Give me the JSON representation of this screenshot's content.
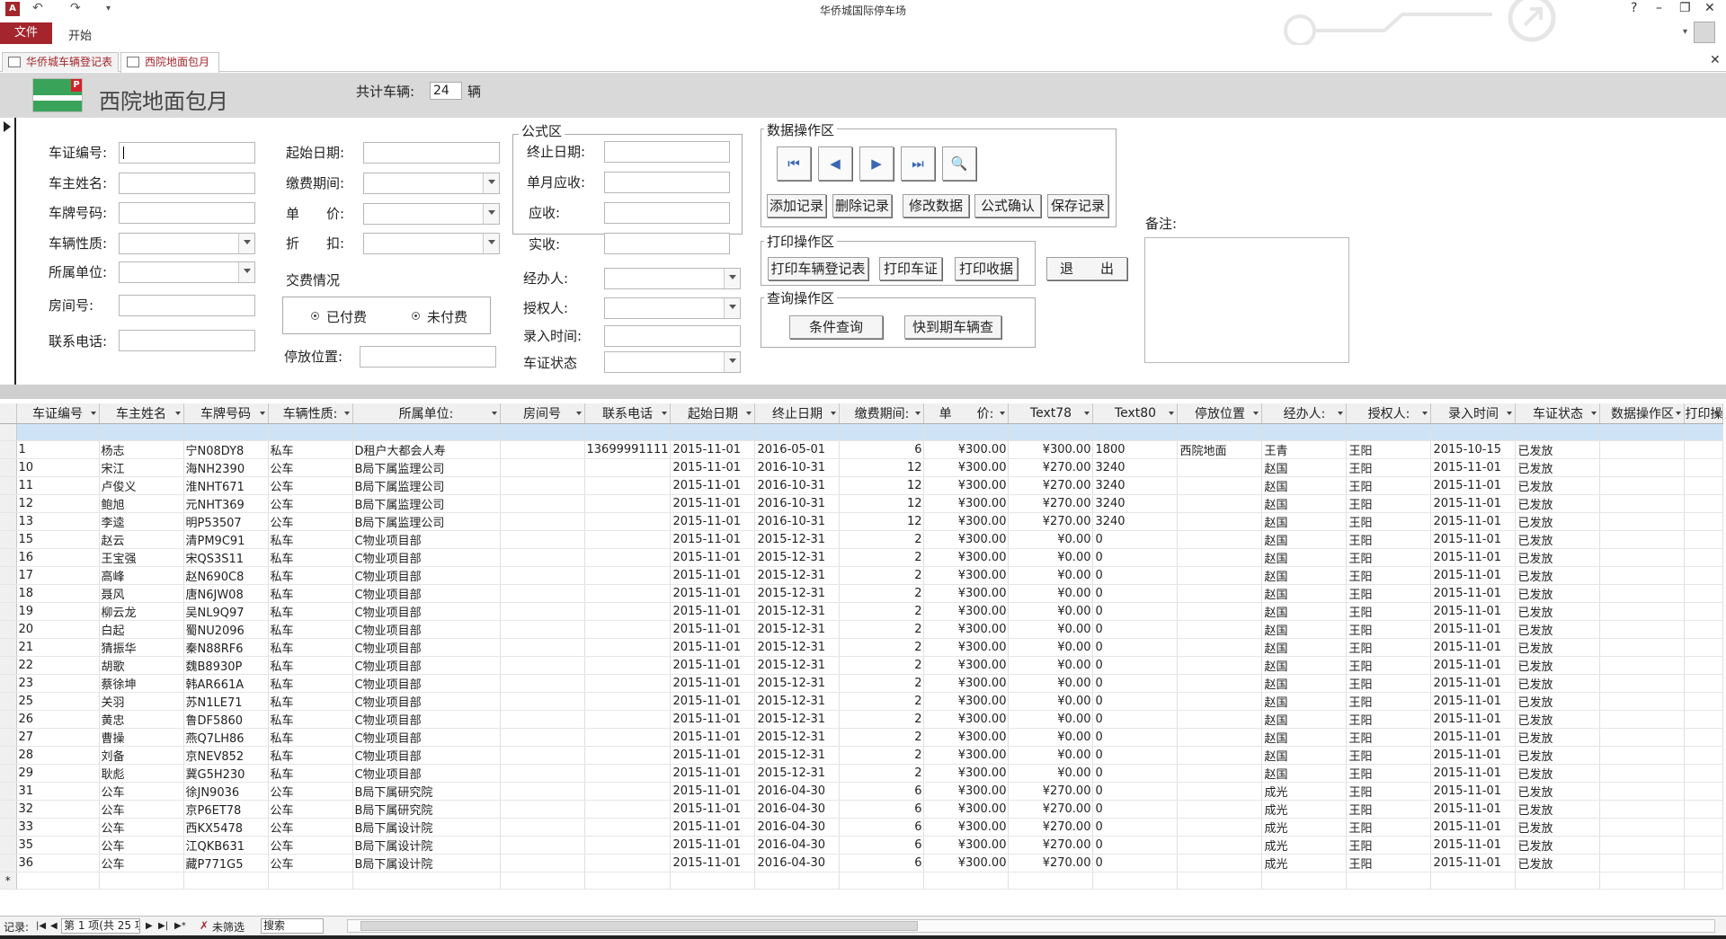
{
  "window": {
    "title": "华侨城国际停车场",
    "help": "?",
    "minimize": "–",
    "restore": "❐",
    "close": "✕"
  },
  "quick_access": {
    "undo": "↶",
    "redo": "↷",
    "customize": "▾"
  },
  "ribbon": {
    "file": "文件",
    "home": "开始"
  },
  "doc_tabs": [
    "华侨城车辆登记表",
    "西院地面包月"
  ],
  "header": {
    "title": "西院地面包月",
    "total_label": "共计车辆:",
    "total_count": "24",
    "total_unit": "辆"
  },
  "form": {
    "labels": {
      "cert_no": "车证编号:",
      "owner": "车主姓名:",
      "plate": "车牌号码:",
      "nature": "车辆性质:",
      "unit": "所属单位:",
      "room": "房间号:",
      "phone": "联系电话:",
      "start_date": "起始日期:",
      "pay_period": "缴费期间:",
      "price": "单　　价:",
      "discount": "折　　扣:",
      "payment": "交费情况",
      "paid": "已付费",
      "unpaid": "未付费",
      "park_pos": "停放位置:",
      "formula_area": "公式区",
      "end_date": "终止日期:",
      "monthly_due": "单月应收:",
      "due": "应收:",
      "received": "实收:",
      "handler": "经办人:",
      "authorizer": "授权人:",
      "entry_time": "录入时间:",
      "cert_status": "车证状态",
      "data_ops": "数据操作区",
      "print_ops": "打印操作区",
      "query_ops": "查询操作区",
      "notes": "备注:"
    },
    "buttons": {
      "add": "添加记录",
      "delete": "删除记录",
      "edit": "修改数据",
      "formula": "公式确认",
      "save": "保存记录",
      "print_reg": "打印车辆登记表",
      "print_cert": "打印车证",
      "print_receipt": "打印收据",
      "exit": "退　　出",
      "cond_query": "条件查询",
      "expiring_query": "快到期车辆查"
    },
    "nav_icons": {
      "first": "⏮",
      "prev": "◀",
      "next": "▶",
      "last": "⏭",
      "find": "🔍"
    }
  },
  "table": {
    "columns": [
      "车证编号",
      "车主姓名",
      "车牌号码",
      "车辆性质:",
      "所属单位:",
      "房间号",
      "联系电话",
      "起始日期",
      "终止日期",
      "缴费期间:",
      "单　　价:",
      "Text78",
      "Text80",
      "停放位置",
      "经办人:",
      "授权人:",
      "录入时间",
      "车证状态",
      "数据操作区",
      "打印操"
    ],
    "rows": [
      [
        "1",
        "杨志",
        "宁N08DY8",
        "私车",
        "D租户大都会人寿",
        "",
        "13699991111",
        "2015-11-01",
        "2016-05-01",
        "6",
        "¥300.00",
        "¥300.00",
        "1800",
        "西院地面",
        "王青",
        "王阳",
        "2015-10-15",
        "已发放",
        "",
        ""
      ],
      [
        "10",
        "宋江",
        "海NH2390",
        "公车",
        "B局下属监理公司",
        "",
        "",
        "2015-11-01",
        "2016-10-31",
        "12",
        "¥300.00",
        "¥270.00",
        "3240",
        "",
        "赵国",
        "王阳",
        "2015-11-01",
        "已发放",
        "",
        ""
      ],
      [
        "11",
        "卢俊义",
        "淮NHT671",
        "公车",
        "B局下属监理公司",
        "",
        "",
        "2015-11-01",
        "2016-10-31",
        "12",
        "¥300.00",
        "¥270.00",
        "3240",
        "",
        "赵国",
        "王阳",
        "2015-11-01",
        "已发放",
        "",
        ""
      ],
      [
        "12",
        "鲍旭",
        "元NHT369",
        "公车",
        "B局下属监理公司",
        "",
        "",
        "2015-11-01",
        "2016-10-31",
        "12",
        "¥300.00",
        "¥270.00",
        "3240",
        "",
        "赵国",
        "王阳",
        "2015-11-01",
        "已发放",
        "",
        ""
      ],
      [
        "13",
        "李逵",
        "明P53507",
        "公车",
        "B局下属监理公司",
        "",
        "",
        "2015-11-01",
        "2016-10-31",
        "12",
        "¥300.00",
        "¥270.00",
        "3240",
        "",
        "赵国",
        "王阳",
        "2015-11-01",
        "已发放",
        "",
        ""
      ],
      [
        "15",
        "赵云",
        "清PM9C91",
        "私车",
        "C物业项目部",
        "",
        "",
        "2015-11-01",
        "2015-12-31",
        "2",
        "¥300.00",
        "¥0.00",
        "0",
        "",
        "赵国",
        "王阳",
        "2015-11-01",
        "已发放",
        "",
        ""
      ],
      [
        "16",
        "王宝强",
        "宋QS3S11",
        "私车",
        "C物业项目部",
        "",
        "",
        "2015-11-01",
        "2015-12-31",
        "2",
        "¥300.00",
        "¥0.00",
        "0",
        "",
        "赵国",
        "王阳",
        "2015-11-01",
        "已发放",
        "",
        ""
      ],
      [
        "17",
        "高峰",
        "赵N690C8",
        "私车",
        "C物业项目部",
        "",
        "",
        "2015-11-01",
        "2015-12-31",
        "2",
        "¥300.00",
        "¥0.00",
        "0",
        "",
        "赵国",
        "王阳",
        "2015-11-01",
        "已发放",
        "",
        ""
      ],
      [
        "18",
        "聂风",
        "唐N6JW08",
        "私车",
        "C物业项目部",
        "",
        "",
        "2015-11-01",
        "2015-12-31",
        "2",
        "¥300.00",
        "¥0.00",
        "0",
        "",
        "赵国",
        "王阳",
        "2015-11-01",
        "已发放",
        "",
        ""
      ],
      [
        "19",
        "柳云龙",
        "吴NL9Q97",
        "私车",
        "C物业项目部",
        "",
        "",
        "2015-11-01",
        "2015-12-31",
        "2",
        "¥300.00",
        "¥0.00",
        "0",
        "",
        "赵国",
        "王阳",
        "2015-11-01",
        "已发放",
        "",
        ""
      ],
      [
        "20",
        "白起",
        "蜀NU2096",
        "私车",
        "C物业项目部",
        "",
        "",
        "2015-11-01",
        "2015-12-31",
        "2",
        "¥300.00",
        "¥0.00",
        "0",
        "",
        "赵国",
        "王阳",
        "2015-11-01",
        "已发放",
        "",
        ""
      ],
      [
        "21",
        "猜振华",
        "秦N88RF6",
        "私车",
        "C物业项目部",
        "",
        "",
        "2015-11-01",
        "2015-12-31",
        "2",
        "¥300.00",
        "¥0.00",
        "0",
        "",
        "赵国",
        "王阳",
        "2015-11-01",
        "已发放",
        "",
        ""
      ],
      [
        "22",
        "胡歌",
        "魏B8930P",
        "私车",
        "C物业项目部",
        "",
        "",
        "2015-11-01",
        "2015-12-31",
        "2",
        "¥300.00",
        "¥0.00",
        "0",
        "",
        "赵国",
        "王阳",
        "2015-11-01",
        "已发放",
        "",
        ""
      ],
      [
        "23",
        "蔡徐坤",
        "韩AR661A",
        "私车",
        "C物业项目部",
        "",
        "",
        "2015-11-01",
        "2015-12-31",
        "2",
        "¥300.00",
        "¥0.00",
        "0",
        "",
        "赵国",
        "王阳",
        "2015-11-01",
        "已发放",
        "",
        ""
      ],
      [
        "25",
        "关羽",
        "苏N1LE71",
        "私车",
        "C物业项目部",
        "",
        "",
        "2015-11-01",
        "2015-12-31",
        "2",
        "¥300.00",
        "¥0.00",
        "0",
        "",
        "赵国",
        "王阳",
        "2015-11-01",
        "已发放",
        "",
        ""
      ],
      [
        "26",
        "黄忠",
        "鲁DF5860",
        "私车",
        "C物业项目部",
        "",
        "",
        "2015-11-01",
        "2015-12-31",
        "2",
        "¥300.00",
        "¥0.00",
        "0",
        "",
        "赵国",
        "王阳",
        "2015-11-01",
        "已发放",
        "",
        ""
      ],
      [
        "27",
        "曹操",
        "燕Q7LH86",
        "私车",
        "C物业项目部",
        "",
        "",
        "2015-11-01",
        "2015-12-31",
        "2",
        "¥300.00",
        "¥0.00",
        "0",
        "",
        "赵国",
        "王阳",
        "2015-11-01",
        "已发放",
        "",
        ""
      ],
      [
        "28",
        "刘备",
        "京NEV852",
        "私车",
        "C物业项目部",
        "",
        "",
        "2015-11-01",
        "2015-12-31",
        "2",
        "¥300.00",
        "¥0.00",
        "0",
        "",
        "赵国",
        "王阳",
        "2015-11-01",
        "已发放",
        "",
        ""
      ],
      [
        "29",
        "耿彪",
        "冀G5H230",
        "私车",
        "C物业项目部",
        "",
        "",
        "2015-11-01",
        "2015-12-31",
        "2",
        "¥300.00",
        "¥0.00",
        "0",
        "",
        "赵国",
        "王阳",
        "2015-11-01",
        "已发放",
        "",
        ""
      ],
      [
        "31",
        "公车",
        "徐JN9036",
        "公车",
        "B局下属研究院",
        "",
        "",
        "2015-11-01",
        "2016-04-30",
        "6",
        "¥300.00",
        "¥270.00",
        "0",
        "",
        "成光",
        "王阳",
        "2015-11-01",
        "已发放",
        "",
        ""
      ],
      [
        "32",
        "公车",
        "京P6ET78",
        "公车",
        "B局下属研究院",
        "",
        "",
        "2015-11-01",
        "2016-04-30",
        "6",
        "¥300.00",
        "¥270.00",
        "0",
        "",
        "成光",
        "王阳",
        "2015-11-01",
        "已发放",
        "",
        ""
      ],
      [
        "33",
        "公车",
        "西KX5478",
        "公车",
        "B局下属设计院",
        "",
        "",
        "2015-11-01",
        "2016-04-30",
        "6",
        "¥300.00",
        "¥270.00",
        "0",
        "",
        "成光",
        "王阳",
        "2015-11-01",
        "已发放",
        "",
        ""
      ],
      [
        "35",
        "公车",
        "江QKB631",
        "公车",
        "B局下属设计院",
        "",
        "",
        "2015-11-01",
        "2016-04-30",
        "6",
        "¥300.00",
        "¥270.00",
        "0",
        "",
        "成光",
        "王阳",
        "2015-11-01",
        "已发放",
        "",
        ""
      ],
      [
        "36",
        "公车",
        "藏P771G5",
        "公车",
        "B局下属设计院",
        "",
        "",
        "2015-11-01",
        "2016-04-30",
        "6",
        "¥300.00",
        "¥270.00",
        "0",
        "",
        "成光",
        "王阳",
        "2015-11-01",
        "已发放",
        "",
        ""
      ]
    ],
    "new_row_marker": "*"
  },
  "statusbar": {
    "record_label": "记录:",
    "position": "第 1 项(共 25 项",
    "no_filter": "未筛选",
    "search": "搜索",
    "nav": {
      "first": "|◀",
      "prev": "◀",
      "next": "▶",
      "last": "▶|",
      "new": "▶*"
    }
  }
}
